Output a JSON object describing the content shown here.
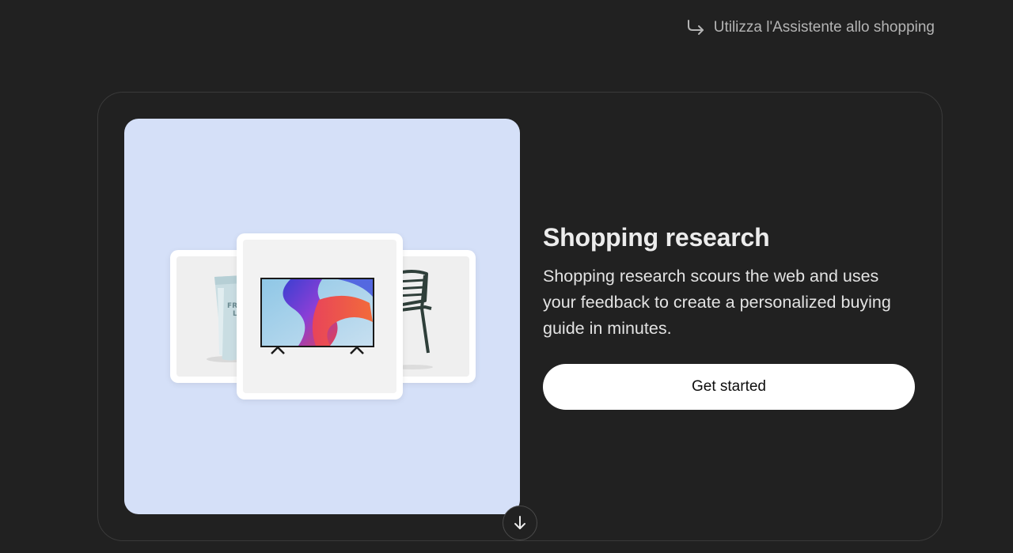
{
  "header": {
    "assistant_link_label": "Utilizza l'Assistente allo shopping",
    "assistant_link_icon": "arrow-turn-right-icon"
  },
  "promo": {
    "title": "Shopping research",
    "description": "Shopping research scours the web and uses your feedback to create a personalized buying guide in minutes.",
    "cta_label": "Get started",
    "hero_background": "#d5e0f8",
    "products": [
      {
        "name": "skincare-tube",
        "label_lines": [
          "FRO",
          "LA"
        ]
      },
      {
        "name": "television"
      },
      {
        "name": "outdoor-chair"
      }
    ]
  },
  "scroll_button_icon": "arrow-down-icon",
  "colors": {
    "background": "#212121",
    "card_border": "#3a3a3a",
    "button_bg": "#ffffff",
    "button_text": "#0d0d0d"
  }
}
